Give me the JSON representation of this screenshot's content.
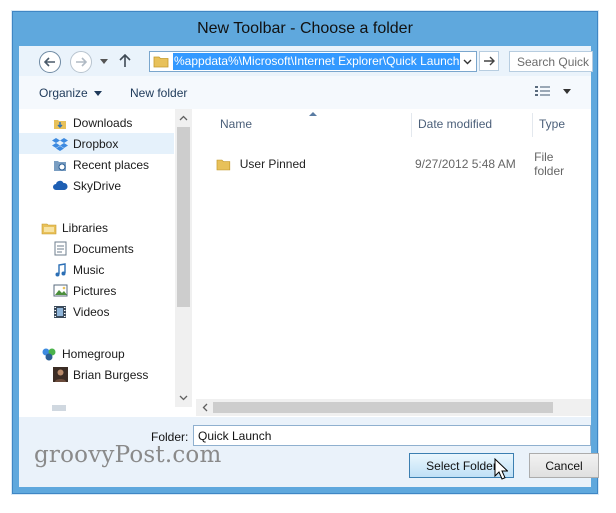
{
  "window": {
    "title": "New Toolbar - Choose a folder"
  },
  "navbar": {
    "address_path": "%appdata%\\Microsoft\\Internet Explorer\\Quick Launch",
    "search_placeholder": "Search Quick ..."
  },
  "toolbar": {
    "organize_label": "Organize",
    "new_folder_label": "New folder"
  },
  "nav_pane": {
    "groups": [
      {
        "items": [
          "Downloads",
          "Dropbox",
          "Recent places",
          "SkyDrive"
        ]
      },
      {
        "header": "Libraries",
        "items": [
          "Documents",
          "Music",
          "Pictures",
          "Videos"
        ]
      },
      {
        "header": "Homegroup",
        "items": [
          "Brian Burgess"
        ]
      }
    ],
    "selected": "Dropbox"
  },
  "file_list": {
    "columns": [
      "Name",
      "Date modified",
      "Type"
    ],
    "rows": [
      {
        "name": "User Pinned",
        "date_modified": "9/27/2012 5:48 AM",
        "type": "File folder"
      }
    ]
  },
  "footer": {
    "folder_label": "Folder:",
    "folder_value": "Quick Launch",
    "select_button": "Select Folder",
    "cancel_button": "Cancel"
  },
  "watermark": "groovyPost.com",
  "colors": {
    "chrome": "#5fa8dd",
    "selection": "#3399ff",
    "folder": "#e8c15a"
  }
}
